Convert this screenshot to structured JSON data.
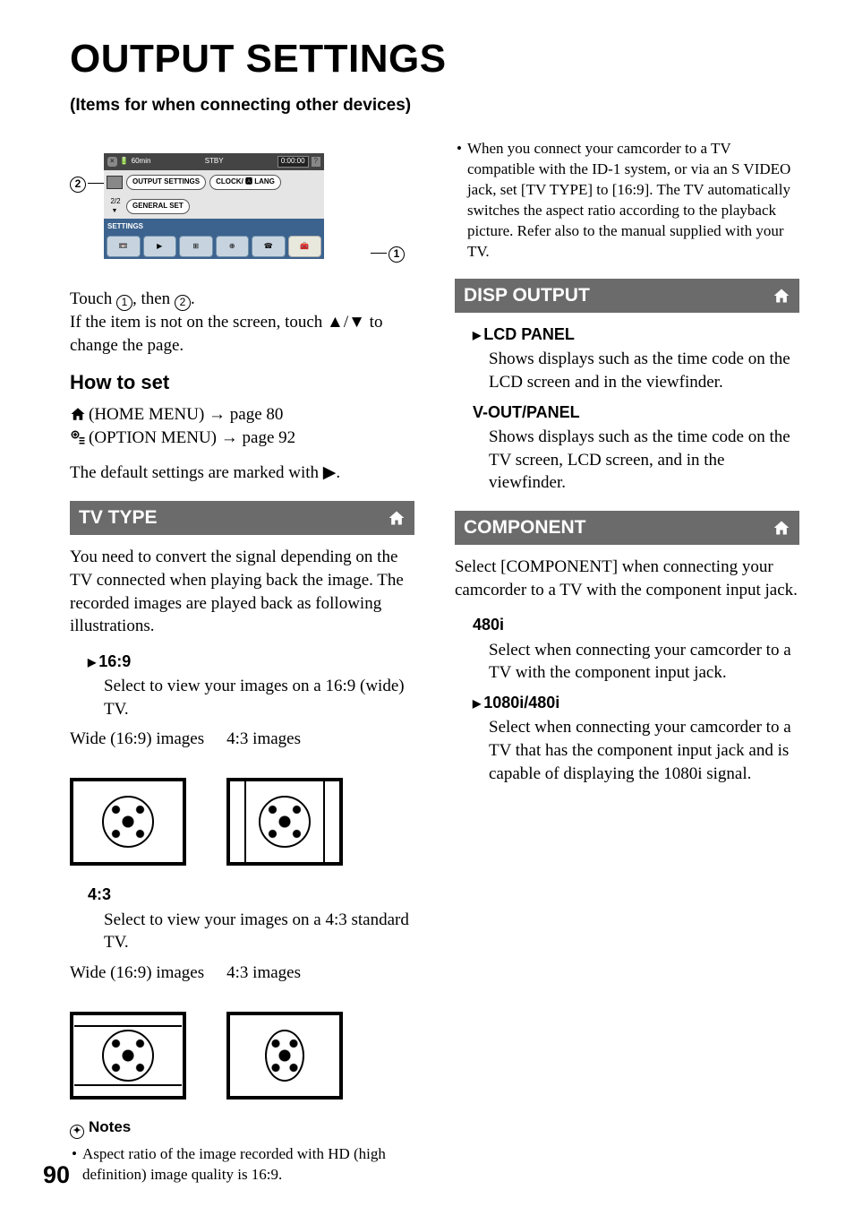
{
  "title": "OUTPUT SETTINGS",
  "subtitle": "(Items for when connecting other devices)",
  "screenshot": {
    "battery": "60min",
    "mode": "STBY",
    "time": "0:00:00",
    "q": "?",
    "output_settings": "OUTPUT SETTINGS",
    "clock_lang": "CLOCK/ 🅰 LANG",
    "page": "2/2",
    "general_set": "GENERAL SET",
    "settings": "SETTINGS",
    "x": "×"
  },
  "callouts": {
    "c1": "1",
    "c2": "2"
  },
  "intro": {
    "touch_prefix": "Touch ",
    "touch_mid": ", then ",
    "touch_suffix": ".",
    "not_on_screen": "If the item is not on the screen, touch ▲/▼ to change the page."
  },
  "how_to_set": {
    "heading": "How to set",
    "home_menu": "(HOME MENU) → page 80",
    "option_menu": "(OPTION MENU) → page 92",
    "default_note": "The default settings are marked with ▶."
  },
  "tv_type": {
    "bar": "TV TYPE",
    "intro": "You need to convert the signal depending on the TV connected when playing back the image. The recorded images are played back as following illustrations.",
    "opt1": {
      "title": "16:9",
      "body": "Select to view your images on a 16:9 (wide) TV."
    },
    "opt2": {
      "title": "4:3",
      "body": "Select to view your images on a 4:3 standard TV."
    },
    "labels": {
      "wide": "Wide (16:9) images",
      "std": "4:3 images"
    }
  },
  "notes": {
    "heading": "Notes",
    "n1": "Aspect ratio of the image recorded with HD (high definition) image quality is 16:9.",
    "n2": "When you connect your camcorder to a TV compatible with the ID-1 system, or via an S VIDEO jack, set [TV TYPE] to [16:9]. The TV automatically switches the aspect ratio according to the playback picture. Refer also to the manual supplied with your TV."
  },
  "disp_output": {
    "bar": "DISP OUTPUT",
    "lcd": {
      "title": "LCD PANEL",
      "body": "Shows displays such as the time code on the LCD screen and in the viewfinder."
    },
    "vout": {
      "title": "V-OUT/PANEL",
      "body": "Shows displays such as the time code on the TV screen, LCD screen, and in the viewfinder."
    }
  },
  "component": {
    "bar": "COMPONENT",
    "intro": "Select [COMPONENT] when connecting your camcorder to a TV with the component input jack.",
    "o1": {
      "title": "480i",
      "body": "Select when connecting your camcorder to a TV with the component input jack."
    },
    "o2": {
      "title": "1080i/480i",
      "body": "Select when connecting your camcorder to a TV that has the component input jack and is capable of displaying the 1080i signal."
    }
  },
  "page_number": "90"
}
